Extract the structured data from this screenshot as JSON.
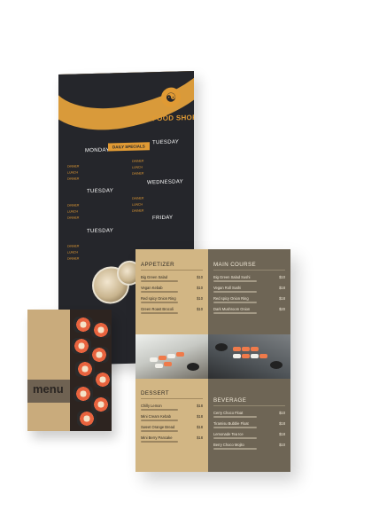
{
  "tall_menu": {
    "shop_name": "FOOD SHOP",
    "logo_icon": "yin-yang-icon",
    "special_label": "DAILY SPECIALS",
    "days": [
      "MONDAY",
      "TUESDAY",
      "TUESDAY",
      "WEDNESDAY",
      "TUESDAY",
      "FRIDAY"
    ],
    "row_labels": [
      "DINNER",
      "LUNCH",
      "DINNER"
    ],
    "colors": {
      "background": "#25262b",
      "accent": "#e09a34"
    }
  },
  "trifold": {
    "title": "menu",
    "colors": {
      "panel": "#c9ab7c",
      "band": "#6f6252"
    }
  },
  "square_menu": {
    "appetizer": {
      "title": "APPETIZER",
      "items": [
        {
          "name": "Big Green Salad",
          "price": "$10"
        },
        {
          "name": "Vegan Kebab",
          "price": "$10"
        },
        {
          "name": "Red spicy Onion Ring",
          "price": "$10"
        },
        {
          "name": "Green Roast Brocoli",
          "price": "$10"
        }
      ]
    },
    "main_course": {
      "title": "MAIN COURSE",
      "items": [
        {
          "name": "Big Green Salad Sushi",
          "price": "$10"
        },
        {
          "name": "Vegan Roll Sushi",
          "price": "$18"
        },
        {
          "name": "Red spicy Onion Ring",
          "price": "$18"
        },
        {
          "name": "Dark Mushroom Onion",
          "price": "$20"
        }
      ]
    },
    "dessert": {
      "title": "DESSERT",
      "items": [
        {
          "name": "Chilly Lemon",
          "price": "$18"
        },
        {
          "name": "Mini Cream Kebab",
          "price": "$18"
        },
        {
          "name": "Sweet Orange Bread",
          "price": "$18"
        },
        {
          "name": "Mini Berry Pancake",
          "price": "$18"
        }
      ]
    },
    "beverage": {
      "title": "BEVERAGE",
      "items": [
        {
          "name": "Cerry Choco Float",
          "price": "$10"
        },
        {
          "name": "Tiramisu Bubble Float",
          "price": "$18"
        },
        {
          "name": "Lemonade Tea Ice",
          "price": "$18"
        },
        {
          "name": "Berry Choco Mojito",
          "price": "$10"
        }
      ]
    },
    "colors": {
      "beige": "#d2b684",
      "taupe": "#6e6555"
    }
  }
}
